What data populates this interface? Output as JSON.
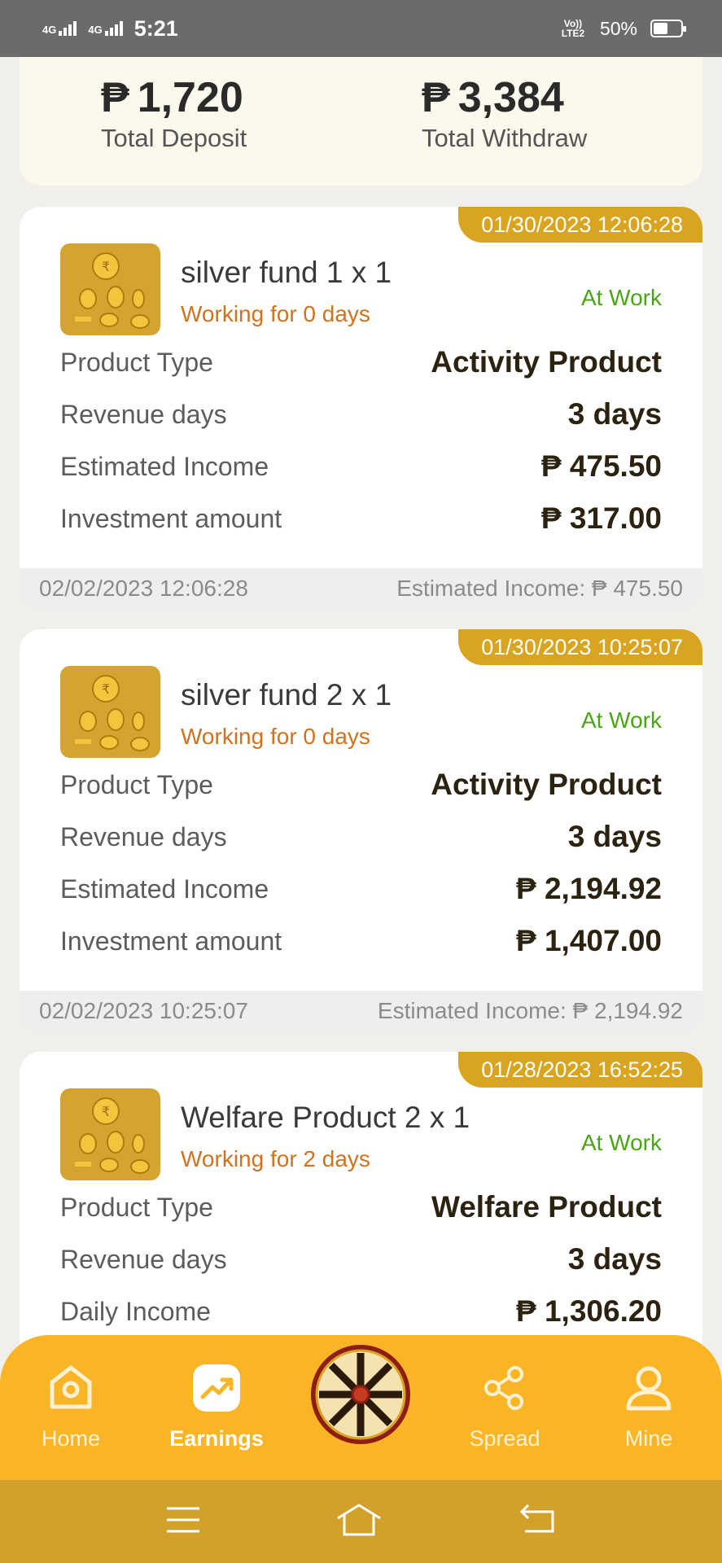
{
  "status_bar": {
    "signal1": "4G",
    "signal2": "4G",
    "time": "5:21",
    "volte": "Vo)) LTE2",
    "battery": "50%",
    "battery_level": 0.5
  },
  "summary": {
    "currency": "₱",
    "deposit_amount": "1,720",
    "deposit_label": "Total Deposit",
    "withdraw_amount": "3,384",
    "withdraw_label": "Total Withdraw"
  },
  "products": [
    {
      "date": "01/30/2023 12:06:28",
      "name": "silver fund 1 x 1",
      "working": "Working for 0 days",
      "status": "At Work",
      "rows": [
        {
          "label": "Product Type",
          "value": "Activity Product"
        },
        {
          "label": "Revenue days",
          "value": "3 days"
        },
        {
          "label": "Estimated Income",
          "value": "₱ 475.50"
        },
        {
          "label": "Investment amount",
          "value": "₱ 317.00"
        }
      ],
      "footer_date": "02/02/2023 12:06:28",
      "footer_income": "Estimated Income: ₱ 475.50"
    },
    {
      "date": "01/30/2023 10:25:07",
      "name": "silver fund 2 x 1",
      "working": "Working for 0 days",
      "status": "At Work",
      "rows": [
        {
          "label": "Product Type",
          "value": "Activity Product"
        },
        {
          "label": "Revenue days",
          "value": "3 days"
        },
        {
          "label": "Estimated Income",
          "value": "₱ 2,194.92"
        },
        {
          "label": "Investment amount",
          "value": "₱ 1,407.00"
        }
      ],
      "footer_date": "02/02/2023 10:25:07",
      "footer_income": "Estimated Income: ₱ 2,194.92"
    },
    {
      "date": "01/28/2023 16:52:25",
      "name": "Welfare Product 2 x 1",
      "working": "Working for 2 days",
      "status": "At Work",
      "rows": [
        {
          "label": "Product Type",
          "value": "Welfare Product"
        },
        {
          "label": "Revenue days",
          "value": "3 days"
        },
        {
          "label": "Daily Income",
          "value": "₱ 1,306.20"
        }
      ]
    }
  ],
  "tabs": {
    "home": "Home",
    "earnings": "Earnings",
    "spread": "Spread",
    "mine": "Mine"
  },
  "colors": {
    "accent": "#f9b525",
    "date_tab": "#d9a520",
    "working": "#d0721e",
    "status_ok": "#4aa516"
  }
}
